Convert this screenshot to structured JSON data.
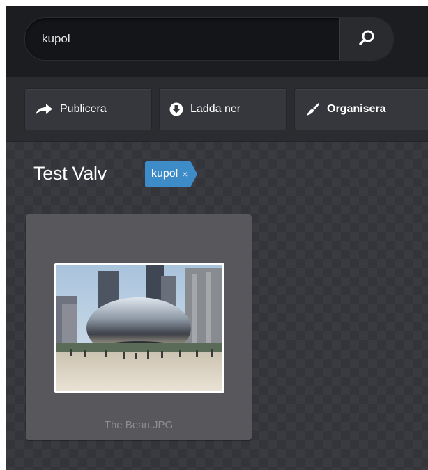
{
  "search": {
    "value": "kupol",
    "icon": "magnifier-icon"
  },
  "toolbar": {
    "publish": {
      "label": "Publicera",
      "icon": "share-arrow-icon"
    },
    "download": {
      "label": "Ladda ner",
      "icon": "download-circle-icon"
    },
    "organize": {
      "label": "Organisera",
      "icon": "brush-icon"
    }
  },
  "vault": {
    "title": "Test Valv",
    "tag": {
      "label": "kupol",
      "remove": "×",
      "color": "#3d8cc8"
    }
  },
  "items": [
    {
      "caption": "The Bean.JPG"
    }
  ]
}
